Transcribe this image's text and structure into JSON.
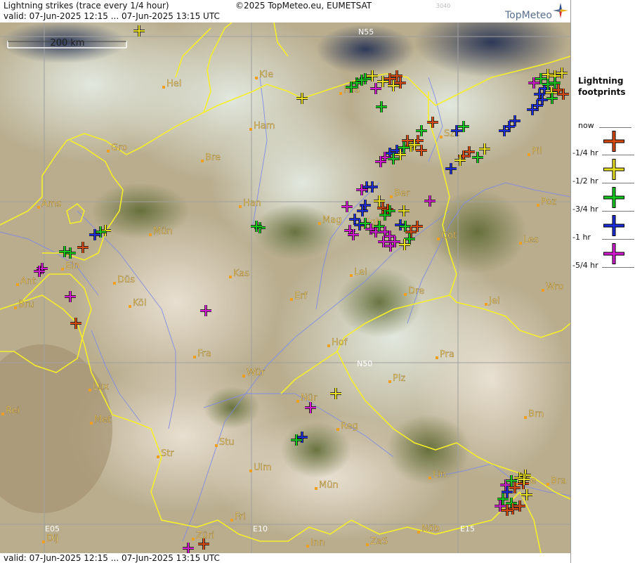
{
  "header": {
    "title": "Lightning strikes (trace every 1/4 hour)",
    "valid": "valid:  07-Jun-2025 12:15 ... 07-Jun-2025 13:15 UTC",
    "copyright": "©2025 TopMeteo.eu, EUMETSAT",
    "code": "3040",
    "brand": "TopMeteo"
  },
  "footer": {
    "valid": "valid:  07-Jun-2025 12:15 ... 07-Jun-2025 13:15 UTC"
  },
  "scale_label": "200 km",
  "grid_labels": [
    "N55",
    "N50",
    "E05",
    "E10",
    "E15"
  ],
  "cities": [
    "Hel",
    "Kie",
    "Ros",
    "Ham",
    "Szc",
    "Gro",
    "Bre",
    "Pil",
    "Ams",
    "Han",
    "Ber",
    "Poz",
    "Mün",
    "Mag",
    "Fgb",
    "Cot",
    "Les",
    "Ein",
    "Kas",
    "Lei",
    "Ant",
    "Düs",
    "Dre",
    "Wro",
    "Bru",
    "Köl",
    "Erf",
    "Jel",
    "Hof",
    "Fra",
    "Pra",
    "Lux",
    "Wür",
    "Plz",
    "Rei",
    "Nür",
    "Met",
    "Reg",
    "Brn",
    "Str",
    "Stu",
    "Ulm",
    "Lin",
    "Mün",
    "Wie",
    "Bra",
    "Fri",
    "Züri",
    "Inn",
    "ZaS",
    "Nöb",
    "Dij"
  ],
  "legend": {
    "title_line1": "Lightning",
    "title_line2": "footprints",
    "items": [
      {
        "label": "now",
        "color": "#d94a10"
      },
      {
        "label": "-1/4 hr",
        "color": "#e8e020"
      },
      {
        "label": "-1/2 hr",
        "color": "#14c81e"
      },
      {
        "label": "-3/4 hr",
        "color": "#1c2cd8"
      },
      {
        "label": "-1 hr",
        "color": "#d21ad2"
      },
      {
        "label": "-5/4 hr",
        "color": ""
      }
    ]
  },
  "colors": {
    "borders": "#f5ef2a",
    "rivers": "#7c88e8",
    "cities": "#f0a020",
    "city_labels": "#f2d070",
    "grid": "#a0a0a0"
  }
}
